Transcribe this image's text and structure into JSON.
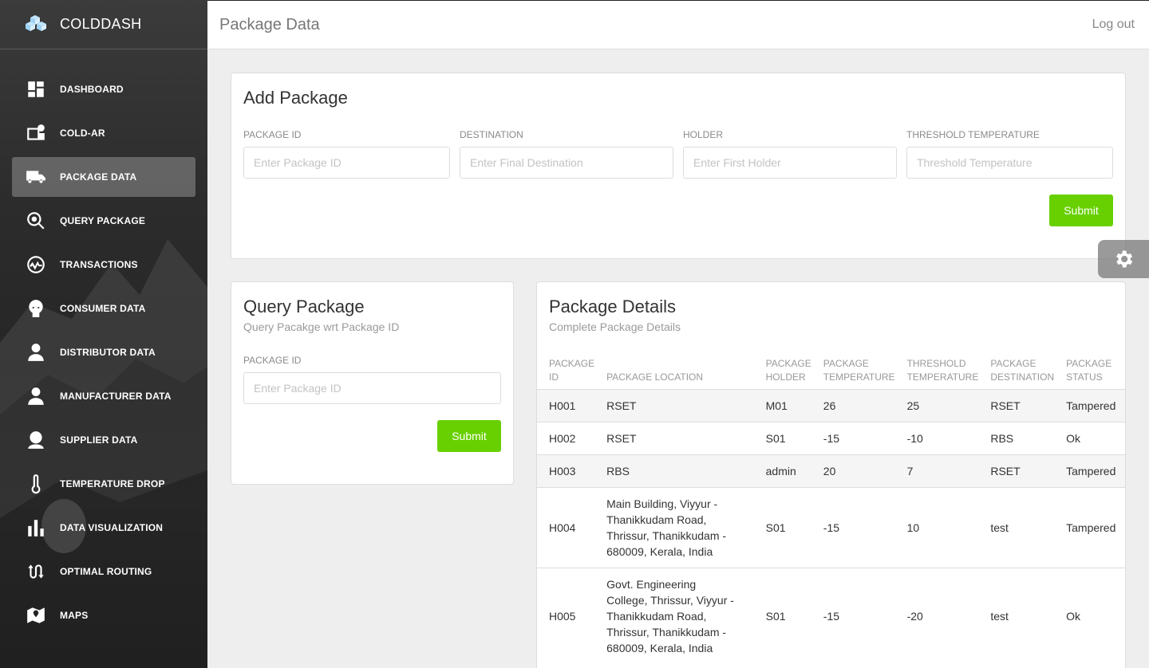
{
  "brand": {
    "name": "COLDDASH"
  },
  "sidebar": {
    "items": [
      {
        "label": "DASHBOARD",
        "icon": "dashboard-icon",
        "active": false
      },
      {
        "label": "COLD-AR",
        "icon": "ar-icon",
        "active": false
      },
      {
        "label": "PACKAGE DATA",
        "icon": "truck-icon",
        "active": true
      },
      {
        "label": "QUERY PACKAGE",
        "icon": "search-icon",
        "active": false
      },
      {
        "label": "TRANSACTIONS",
        "icon": "pulse-icon",
        "active": false
      },
      {
        "label": "CONSUMER DATA",
        "icon": "face-icon",
        "active": false
      },
      {
        "label": "DISTRIBUTOR DATA",
        "icon": "person-icon",
        "active": false
      },
      {
        "label": "MANUFACTURER DATA",
        "icon": "person-icon",
        "active": false
      },
      {
        "label": "SUPPLIER DATA",
        "icon": "person-icon",
        "active": false
      },
      {
        "label": "TEMPERATURE DROP",
        "icon": "thermometer-icon",
        "active": false
      },
      {
        "label": "DATA VISUALIZATION",
        "icon": "bar-chart-icon",
        "active": false
      },
      {
        "label": "OPTIMAL ROUTING",
        "icon": "route-icon",
        "active": false
      },
      {
        "label": "MAPS",
        "icon": "map-icon",
        "active": false
      }
    ]
  },
  "header": {
    "title": "Package Data",
    "logout": "Log out"
  },
  "add_package": {
    "title": "Add Package",
    "fields": [
      {
        "label": "PACKAGE ID",
        "placeholder": "Enter Package ID"
      },
      {
        "label": "DESTINATION",
        "placeholder": "Enter Final Destination"
      },
      {
        "label": "HOLDER",
        "placeholder": "Enter First Holder"
      },
      {
        "label": "THRESHOLD TEMPERATURE",
        "placeholder": "Threshold Temperature"
      }
    ],
    "submit": "Submit"
  },
  "query_package": {
    "title": "Query Package",
    "subtitle": "Query Pacakge wrt Package ID",
    "field_label": "PACKAGE ID",
    "placeholder": "Enter Package ID",
    "submit": "Submit"
  },
  "package_details": {
    "title": "Package Details",
    "subtitle": "Complete Package Details",
    "columns": [
      "PACKAGE ID",
      "PACKAGE LOCATION",
      "PACKAGE HOLDER",
      "PACKAGE TEMPERATURE",
      "THRESHOLD TEMPERATURE",
      "PACKAGE DESTINATION",
      "PACKAGE STATUS"
    ],
    "rows": [
      [
        "H001",
        "RSET",
        "M01",
        "26",
        "25",
        "RSET",
        "Tampered"
      ],
      [
        "H002",
        "RSET",
        "S01",
        "-15",
        "-10",
        "RBS",
        "Ok"
      ],
      [
        "H003",
        "RBS",
        "admin",
        "20",
        "7",
        "RSET",
        "Tampered"
      ],
      [
        "H004",
        "Main Building, Viyyur - Thanikkudam Road, Thrissur, Thanikkudam - 680009, Kerala, India",
        "S01",
        "-15",
        "10",
        "test",
        "Tampered"
      ],
      [
        "H005",
        "Govt. Engineering College, Thrissur, Viyyur - Thanikkudam Road, Thrissur, Thanikkudam - 680009, Kerala, India",
        "S01",
        "-15",
        "-20",
        "test",
        "Ok"
      ]
    ]
  },
  "colors": {
    "accent": "#68d000",
    "sidebar": "#2c2c2c"
  }
}
